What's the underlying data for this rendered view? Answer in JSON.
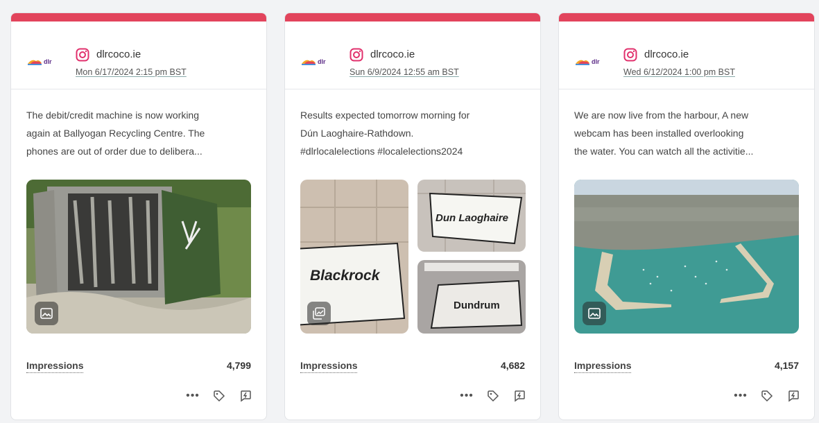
{
  "colors": {
    "accent_bar": "#e2445c",
    "instagram": "#e1306c"
  },
  "cards": [
    {
      "account": "dlrcoco.ie",
      "date": "Mon 6/17/2024 2:15 pm BST",
      "lines": [
        "The debit/credit machine is now working",
        "again at Ballyogan Recycling Centre. The",
        "phones are out of order due to delibera..."
      ],
      "media_icon": "image-icon",
      "impressions_label": "Impressions",
      "impressions": "4,799"
    },
    {
      "account": "dlrcoco.ie",
      "date": "Sun 6/9/2024 12:55 am BST",
      "lines": [
        "Results expected tomorrow morning for",
        "Dún Laoghaire-Rathdown.",
        "#dlrlocalelections #localelections2024"
      ],
      "media_icon": "gallery-icon",
      "sign_texts": [
        "Blackrock",
        "Dun Laoghaire",
        "Dundrum"
      ],
      "impressions_label": "Impressions",
      "impressions": "4,682"
    },
    {
      "account": "dlrcoco.ie",
      "date": "Wed 6/12/2024 1:00 pm BST",
      "lines": [
        "We are now live from the harbour, A new",
        "webcam has been installed overlooking",
        "the water. You can watch all the activitie..."
      ],
      "media_icon": "image-icon",
      "impressions_label": "Impressions",
      "impressions": "4,157"
    }
  ]
}
